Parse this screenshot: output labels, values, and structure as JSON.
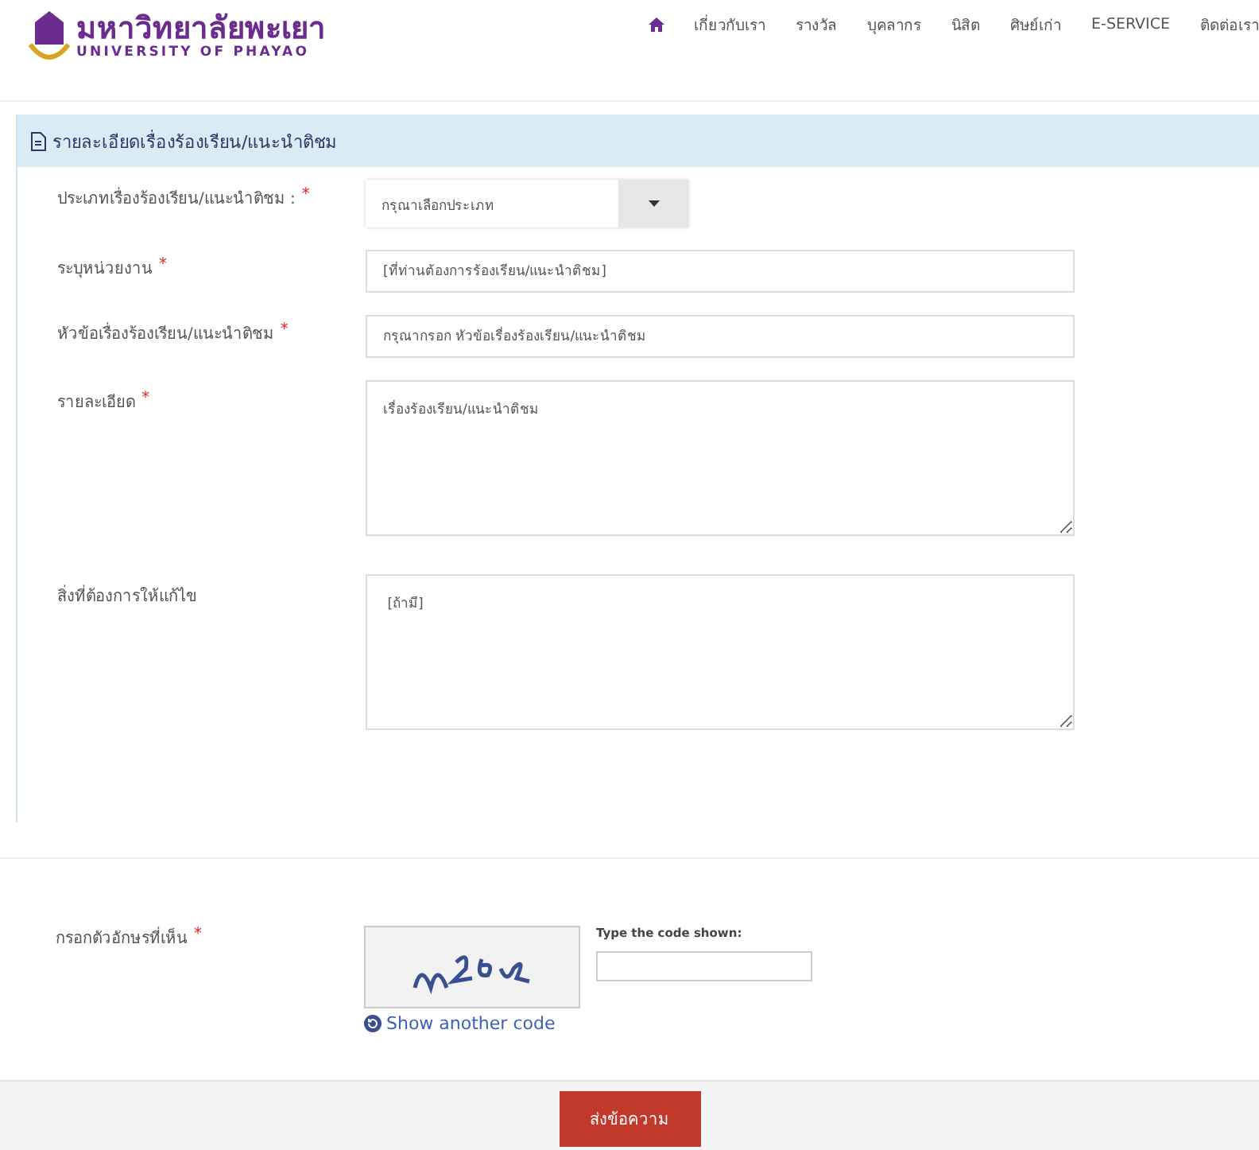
{
  "header": {
    "logo": {
      "name_thai": "มหาวิทยาลัยพะเยา",
      "name_english": "UNIVERSITY OF PHAYAO"
    },
    "nav": [
      {
        "kind": "home"
      },
      {
        "kind": "text",
        "label": "เกี่ยวกับเรา"
      },
      {
        "kind": "text",
        "label": "รางวัล"
      },
      {
        "kind": "text",
        "label": "บุคลากร"
      },
      {
        "kind": "text",
        "label": "นิสิต"
      },
      {
        "kind": "text",
        "label": "ศิษย์เก่า"
      },
      {
        "kind": "text",
        "label": "E-SERVICE"
      },
      {
        "kind": "text",
        "label": "ติดต่อเรา"
      }
    ]
  },
  "panel": {
    "title": "รายละเอียดเรื่องร้องเรียน/แนะนำติชม",
    "fields": [
      {
        "kind": "select",
        "label": "ประเภทเรื่องร้องเรียน/แนะนำติชม :",
        "required_mark": "*",
        "placeholder": "กรุณาเลือกประเภท"
      },
      {
        "kind": "input",
        "label": "ระบุหน่วยงาน",
        "required_mark": "*",
        "placeholder": "[ที่ท่านต้องการร้องเรียน/แนะนำติชม]"
      },
      {
        "kind": "input",
        "label": "หัวข้อเรื่องร้องเรียน/แนะนำติชม",
        "required_mark": "*",
        "placeholder": "กรุณากรอก หัวข้อเรื่องร้องเรียน/แนะนำติชม"
      },
      {
        "kind": "textarea",
        "label": "รายละเอียด",
        "required_mark": "*",
        "placeholder": "เรื่องร้องเรียน/แนะนำติชม"
      },
      {
        "kind": "textarea",
        "label": "สิ่งที่ต้องการให้แก้ไข",
        "placeholder": " [ถ้ามี]"
      }
    ]
  },
  "captcha": {
    "label": "กรอกตัวอักษรที่เห็น",
    "required_mark": "*",
    "prompt": "Type the code shown:",
    "refresh_link": "Show another code"
  },
  "submit_button": "ส่งข้อความ"
}
